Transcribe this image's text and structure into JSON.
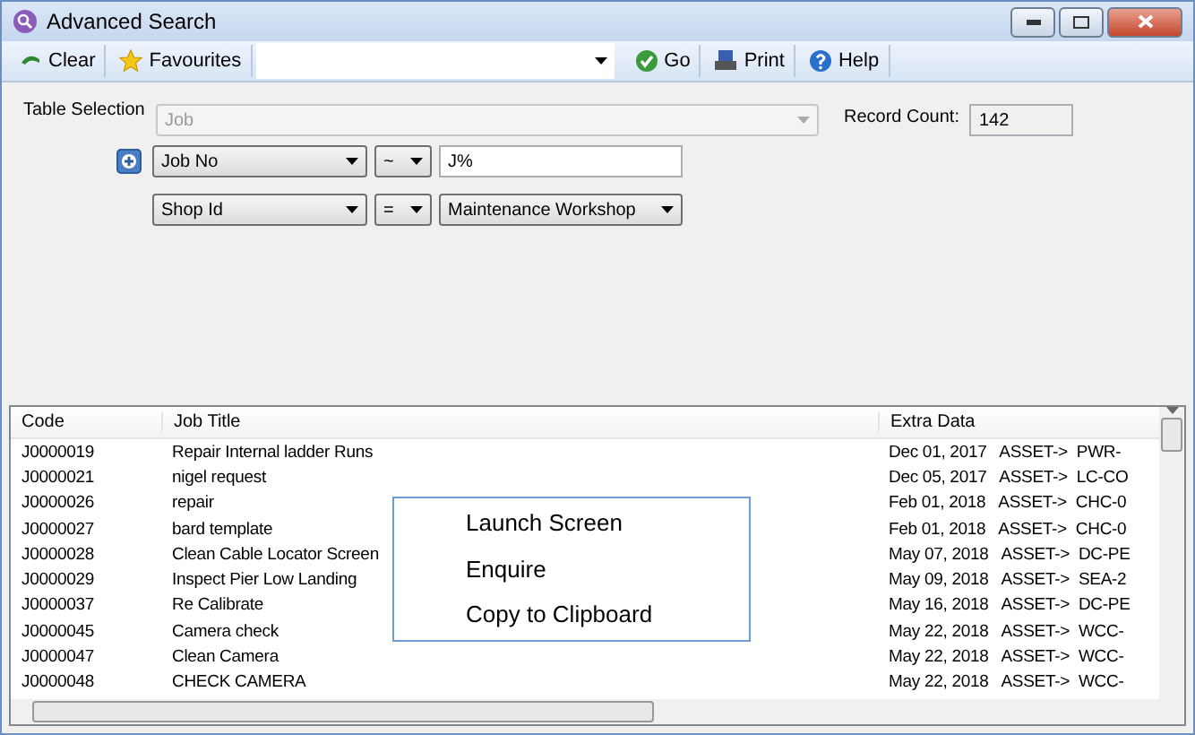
{
  "window": {
    "title": "Advanced Search"
  },
  "toolbar": {
    "buttons": [
      {
        "label": "Clear",
        "kind": "clear"
      },
      {
        "label": "Favourites",
        "kind": "star"
      }
    ],
    "after": [
      {
        "label": "Go",
        "kind": "go"
      },
      {
        "label": "Print",
        "kind": "print"
      },
      {
        "label": "Help",
        "kind": "help"
      }
    ]
  },
  "table_selection": {
    "label": "Table Selection",
    "value": "Job",
    "disabled": true
  },
  "record_count": {
    "label": "Record Count:",
    "value": "142"
  },
  "criteria": [
    {
      "field": "Job No",
      "operator": "~",
      "value": "J%",
      "kind": "text"
    },
    {
      "field": "Shop Id",
      "operator": "=",
      "value": "Maintenance Workshop",
      "kind": "dropdown"
    }
  ],
  "table": {
    "columns": [
      "Code",
      "Job Title",
      "Extra Data"
    ],
    "rows": [
      [
        "J0000019",
        "Repair Internal ladder Runs",
        "Dec 01, 2017   ASSET->  PWR-"
      ],
      [
        "J0000021",
        "nigel request",
        "Dec 05, 2017   ASSET->  LC-CO"
      ],
      [
        "J0000026",
        "repair",
        "Feb 01, 2018   ASSET->  CHC-0"
      ],
      [
        "J0000027",
        "bard template",
        "Feb 01, 2018   ASSET->  CHC-0"
      ],
      [
        "J0000028",
        "Clean Cable Locator Screen",
        "May 07, 2018   ASSET->  DC-PE"
      ],
      [
        "J0000029",
        "Inspect Pier Low Landing",
        "May 09, 2018   ASSET->  SEA-2"
      ],
      [
        "J0000037",
        "Re Calibrate",
        "May 16, 2018   ASSET->  DC-PE"
      ],
      [
        "J0000045",
        "Camera check",
        "May 22, 2018   ASSET->  WCC-"
      ],
      [
        "J0000047",
        "Clean Camera",
        "May 22, 2018   ASSET->  WCC-"
      ],
      [
        "J0000048",
        "CHECK CAMERA",
        "May 22, 2018   ASSET->  WCC-"
      ]
    ]
  },
  "context_menu": [
    "Launch Screen",
    "Enquire",
    "Copy to Clipboard"
  ]
}
